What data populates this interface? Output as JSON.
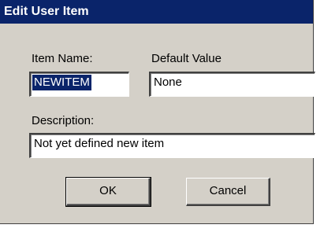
{
  "dialog": {
    "title": "Edit User Item",
    "item_name_label": "Item Name:",
    "item_name_value": "NEWITEM",
    "default_value_label": "Default Value",
    "default_value_value": "None",
    "description_label": "Description:",
    "description_value": "Not yet defined new item",
    "ok_label": "OK",
    "cancel_label": "Cancel"
  },
  "colors": {
    "title_bar": "#0a246a",
    "dialog_face": "#d4d0c8",
    "selection": "#0a246a"
  }
}
